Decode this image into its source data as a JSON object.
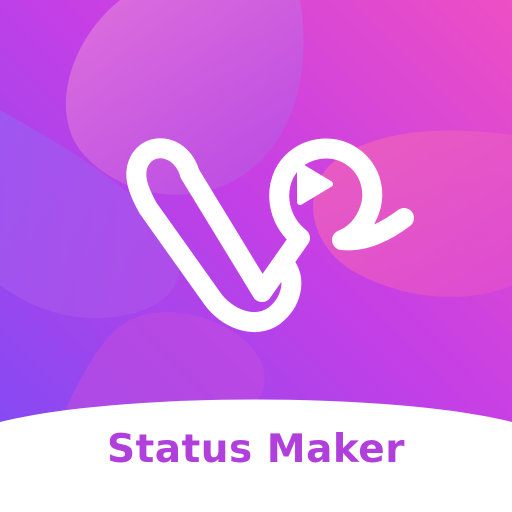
{
  "app": {
    "name": "Status Maker",
    "logo_icon": "v-play-logo-icon",
    "colors": {
      "gradient_start": "#7a4cf5",
      "gradient_mid": "#c43fe6",
      "gradient_end": "#ee4fc4",
      "blob_accent": "#e56ad3",
      "logo_stroke": "#ffffff",
      "title_text": "#b13fdc",
      "footer_background": "#ffffff"
    }
  }
}
